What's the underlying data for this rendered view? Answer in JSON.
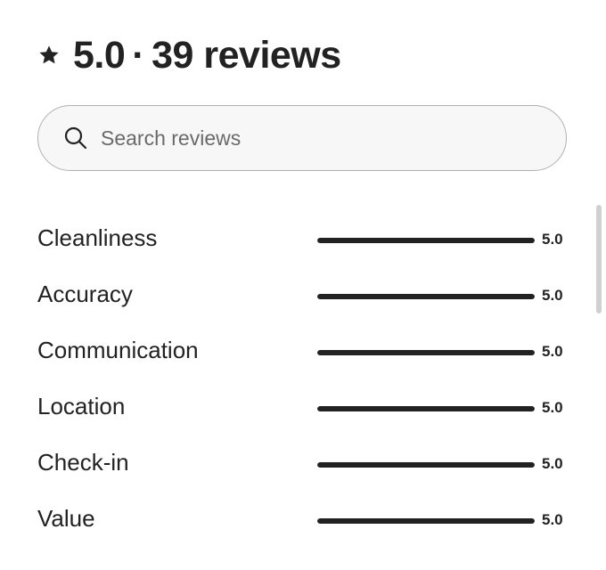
{
  "header": {
    "icon": "star-icon",
    "rating": "5.0",
    "separator": "·",
    "reviews": "39 reviews"
  },
  "search": {
    "icon": "search-icon",
    "placeholder": "Search reviews",
    "value": ""
  },
  "ratings": [
    {
      "label": "Cleanliness",
      "value": "5.0",
      "fraction": 1.0
    },
    {
      "label": "Accuracy",
      "value": "5.0",
      "fraction": 1.0
    },
    {
      "label": "Communication",
      "value": "5.0",
      "fraction": 1.0
    },
    {
      "label": "Location",
      "value": "5.0",
      "fraction": 1.0
    },
    {
      "label": "Check-in",
      "value": "5.0",
      "fraction": 1.0
    },
    {
      "label": "Value",
      "value": "5.0",
      "fraction": 1.0
    }
  ],
  "colors": {
    "text": "#222222",
    "bar_fill": "#222222",
    "bar_track": "#dddddd",
    "search_border": "#b0b0b0"
  }
}
